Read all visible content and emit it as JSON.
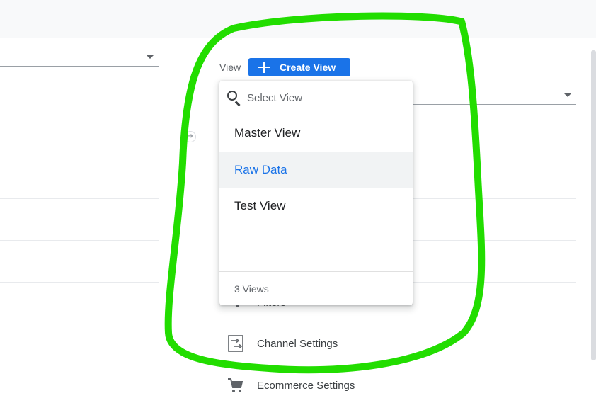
{
  "view_selector": {
    "label": "View",
    "create_button_label": "Create View",
    "dropdown": {
      "search_placeholder": "Select View",
      "items": [
        "Master View",
        "Raw Data",
        "Test View"
      ],
      "selected_item": "Raw Data",
      "footer": "3 Views"
    }
  },
  "view_settings": {
    "items": [
      {
        "label": "Filters",
        "icon": "filter-icon"
      },
      {
        "label": "Channel Settings",
        "icon": "channel-settings-icon"
      },
      {
        "label": "Ecommerce Settings",
        "icon": "cart-icon"
      }
    ]
  },
  "colors": {
    "accent": "#1a73e8",
    "highlight_annotation": "#22dd00",
    "topbar": "#f8f9fa"
  }
}
